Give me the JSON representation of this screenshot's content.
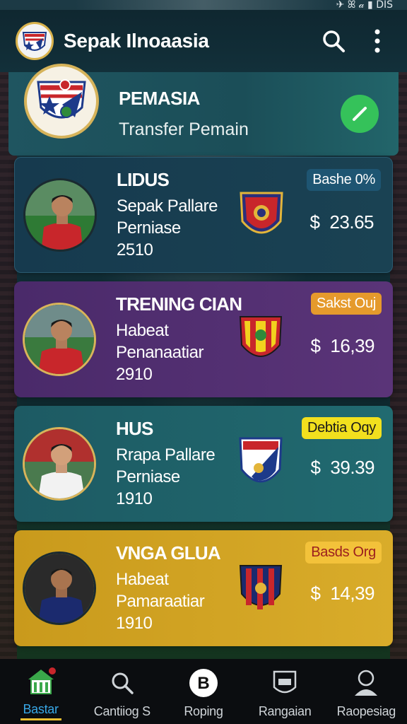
{
  "status_bar": {
    "text": "✈ ꕤ 𝒶 ▮ DIS"
  },
  "app_bar": {
    "title": "Sepak Ilnoaasia",
    "search_icon": "search-icon",
    "menu_icon": "more-vert-icon"
  },
  "header": {
    "title": "PEMASIA",
    "subtitle": "Transfer Pemain",
    "action_icon": "check-icon"
  },
  "players": [
    {
      "name": "LIDUS",
      "line1": "Sepak Pallare",
      "line2": "Perniase",
      "year": "2510",
      "badge": "Bashe 0%",
      "price": "23.65",
      "currency": "$",
      "shirt": "#c8262b"
    },
    {
      "name": "TRENING CIAN",
      "line1": "Habeat",
      "line2": "Penanaatiar",
      "year": "2910",
      "badge": "Sakst Ouj",
      "price": "16,39",
      "currency": "$",
      "shirt": "#c8262b"
    },
    {
      "name": "HUS",
      "line1": "Rrapa Pallare",
      "line2": "Perniase",
      "year": "1910",
      "badge": "Debtia Oqy",
      "price": "39.39",
      "currency": "$",
      "shirt": "#f2f2f2"
    },
    {
      "name": "VNGA GLUA",
      "line1": "Habeat",
      "line2": "Pamaraatiar",
      "year": "1910",
      "badge": "Basds Org",
      "price": "14,39",
      "currency": "$",
      "shirt": "#1b2a6e"
    }
  ],
  "nav": [
    {
      "label": "Bastar",
      "icon": "home-icon",
      "active": true
    },
    {
      "label": "Cantiiog S",
      "icon": "search-icon",
      "active": false
    },
    {
      "label": "Roping",
      "icon": "b-circle-icon",
      "active": false
    },
    {
      "label": "Rangaian",
      "icon": "shield-icon",
      "active": false
    },
    {
      "label": "Raopesiag",
      "icon": "profile-icon",
      "active": false
    }
  ],
  "colors": {
    "accent_green": "#35c25a",
    "nav_active": "#38a7e6",
    "gold": "#d6b35a"
  }
}
